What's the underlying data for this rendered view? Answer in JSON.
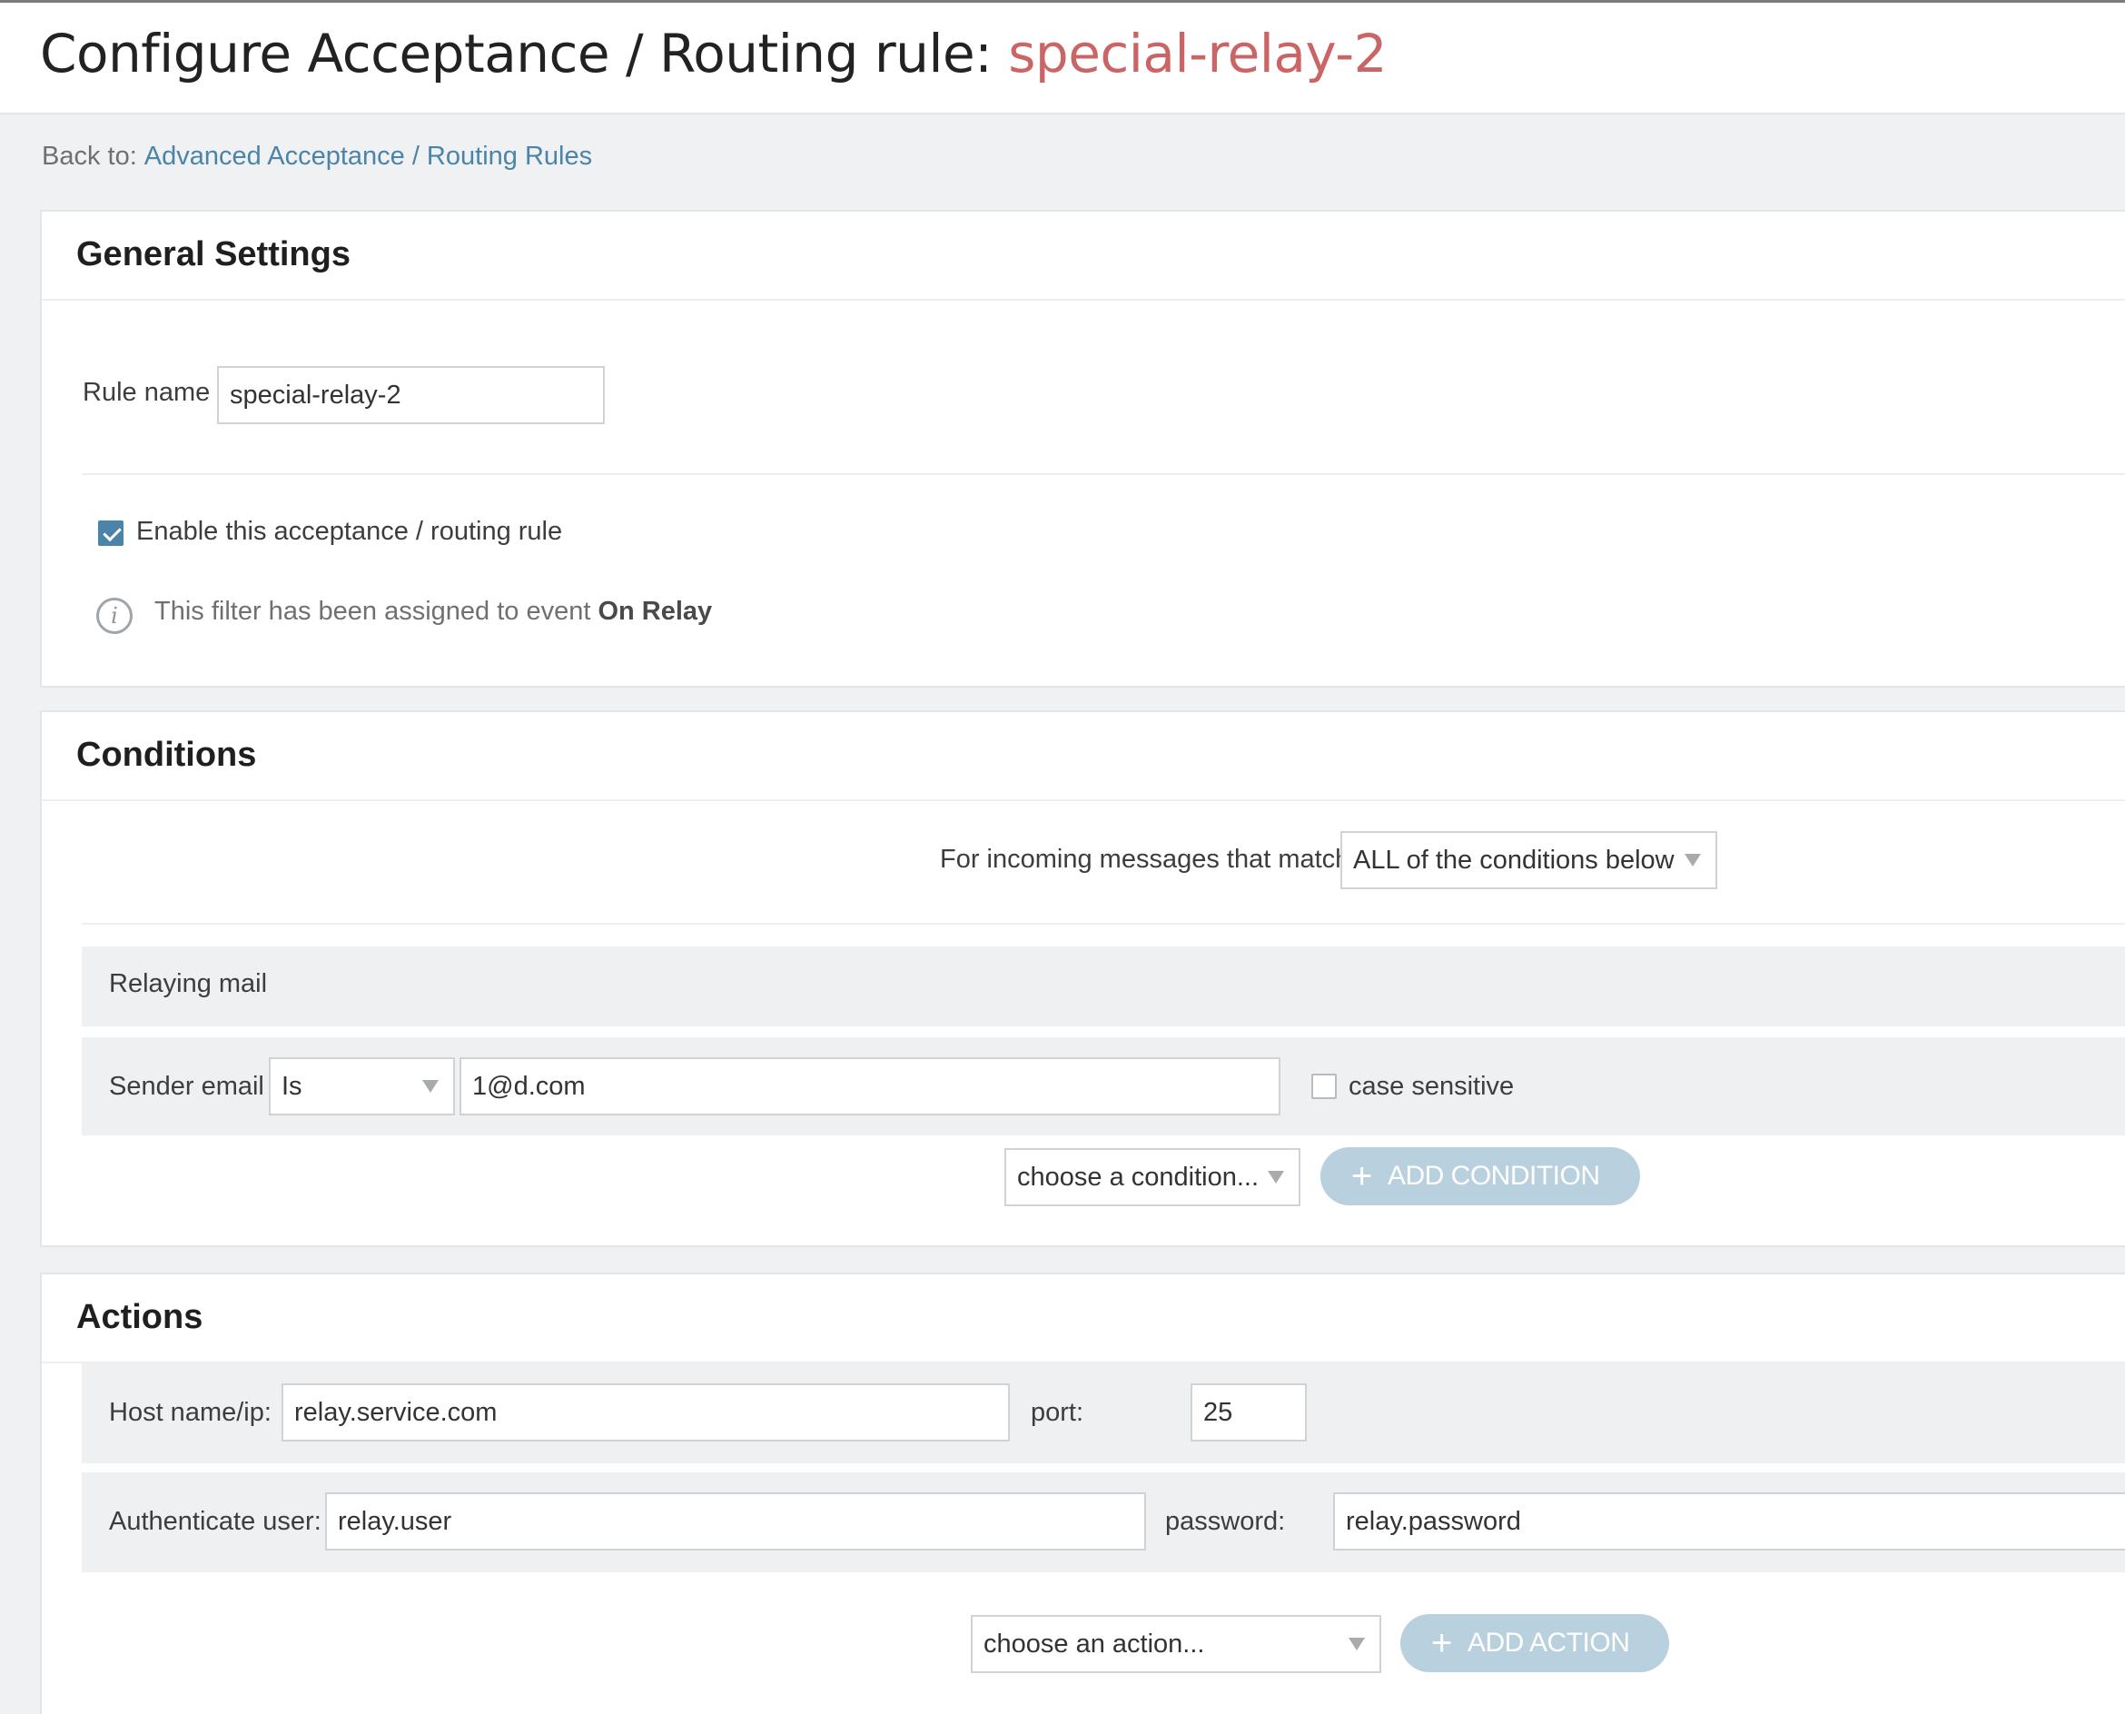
{
  "header": {
    "title_prefix": "Configure Acceptance / Routing rule: ",
    "rule_name": "special-relay-2"
  },
  "breadcrumb": {
    "back_label": "Back to:",
    "back_link": "Advanced Acceptance / Routing Rules"
  },
  "general": {
    "title": "General Settings",
    "rule_name_label": "Rule name",
    "rule_name_value": "special-relay-2",
    "enable_label": "Enable this acceptance / routing rule",
    "enable_checked": true,
    "info_text": "This filter has been assigned to event ",
    "info_event": "On Relay"
  },
  "conditions": {
    "title": "Conditions",
    "match_label": "For incoming messages that match",
    "match_value": "ALL of the conditions below",
    "group_label": "Relaying mail",
    "sender_label": "Sender email",
    "operator_value": "Is",
    "sender_value": "1@d.com",
    "case_label": "case sensitive",
    "case_checked": false,
    "choose_placeholder": "choose a condition...",
    "add_label": "ADD CONDITION"
  },
  "actions": {
    "title": "Actions",
    "host_label": "Host name/ip:",
    "host_value": "relay.service.com",
    "port_label": "port:",
    "port_value": "25",
    "auth_label": "Authenticate user:",
    "auth_value": "relay.user",
    "password_label": "password:",
    "password_value": "relay.password",
    "choose_placeholder": "choose an action...",
    "add_label": "ADD ACTION"
  },
  "colors": {
    "accent": "#4b84a8",
    "title_highlight": "#cb6464",
    "button_disabled": "#b9d1de",
    "page_background": "#eff1f3"
  }
}
